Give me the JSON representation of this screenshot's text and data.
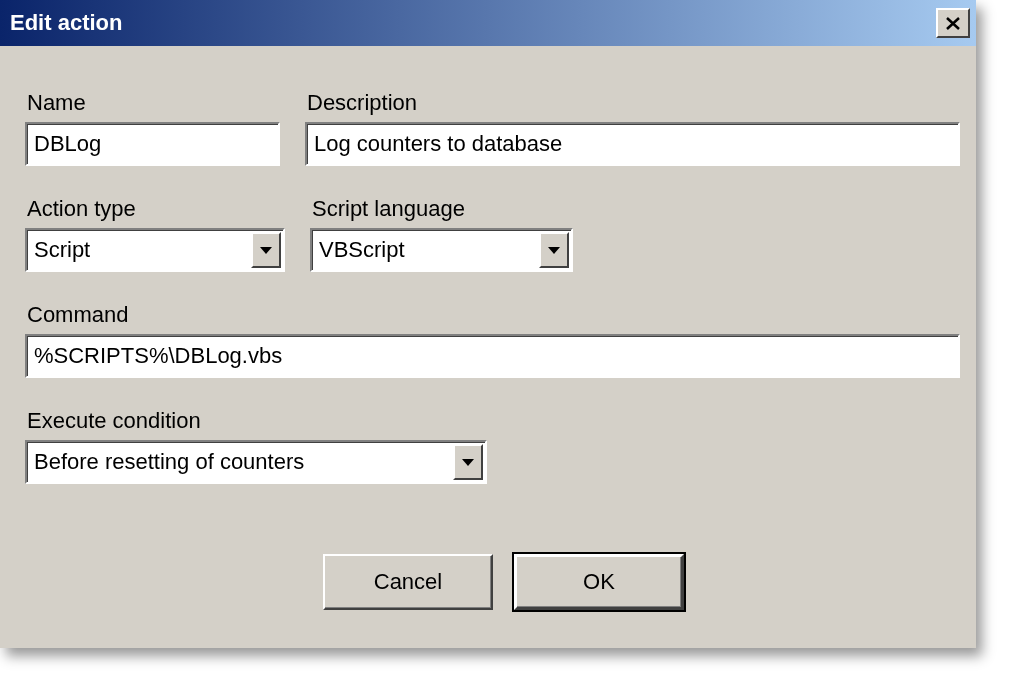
{
  "window": {
    "title": "Edit action"
  },
  "rows": [
    {
      "fields": [
        {
          "kind": "text",
          "label": "Name",
          "value": "DBLog"
        },
        {
          "kind": "text",
          "label": "Description",
          "value": "Log counters to database"
        }
      ]
    },
    {
      "fields": [
        {
          "kind": "combo",
          "label": "Action type",
          "value": "Script"
        },
        {
          "kind": "combo",
          "label": "Script language",
          "value": "VBScript"
        }
      ]
    },
    {
      "fields": [
        {
          "kind": "text",
          "label": "Command",
          "value": "%SCRIPTS%\\DBLog.vbs"
        }
      ]
    },
    {
      "fields": [
        {
          "kind": "combo",
          "label": "Execute condition",
          "value": "Before resetting of counters"
        }
      ]
    }
  ],
  "buttons": [
    {
      "label": "Cancel",
      "default": false
    },
    {
      "label": "OK",
      "default": true
    }
  ]
}
